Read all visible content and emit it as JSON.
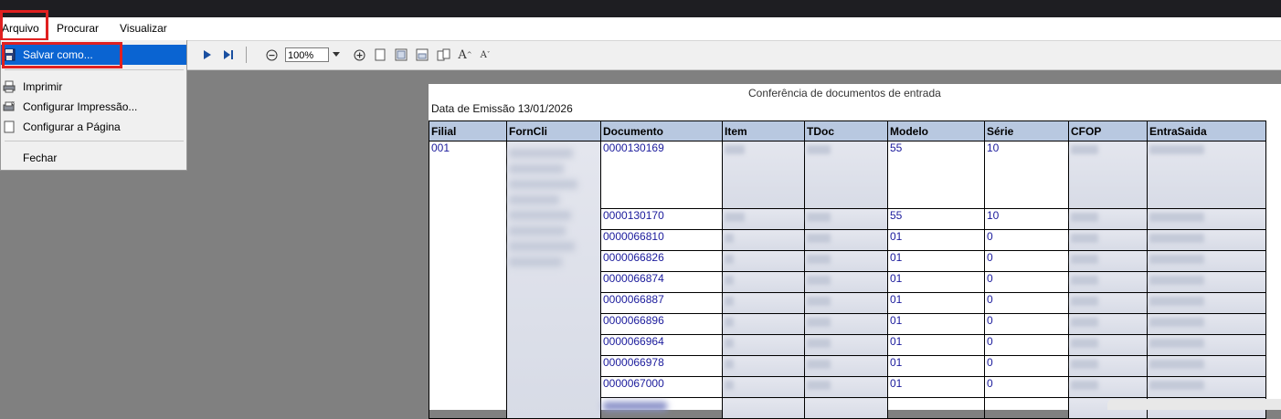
{
  "menubar": {
    "items": [
      {
        "label": "Arquivo"
      },
      {
        "label": "Procurar"
      },
      {
        "label": "Visualizar"
      }
    ]
  },
  "dropdown": {
    "items": [
      {
        "label": "Salvar como...",
        "icon": "save-icon",
        "highlighted": true
      },
      {
        "label": "Imprimir",
        "icon": "printer-icon"
      },
      {
        "label": "Configurar Impressão...",
        "icon": "print-setup-icon"
      },
      {
        "label": "Configurar a Página",
        "icon": "page-setup-icon"
      },
      {
        "label": "Fechar",
        "icon": ""
      }
    ]
  },
  "toolbar": {
    "zoom_value": "100%"
  },
  "report": {
    "title": "Conferência de documentos de entrada",
    "emission": "Data de Emissão 13/01/2026",
    "columns": [
      "Filial",
      "FornCli",
      "Documento",
      "Item",
      "TDoc",
      "Modelo",
      "Série",
      "CFOP",
      "EntraSaida"
    ],
    "filial": "001",
    "rows": [
      {
        "documento": "0000130169",
        "modelo": "55",
        "serie": "10"
      },
      {
        "documento": "0000130170",
        "modelo": "55",
        "serie": "10"
      },
      {
        "documento": "0000066810",
        "modelo": "01",
        "serie": "0"
      },
      {
        "documento": "0000066826",
        "modelo": "01",
        "serie": "0"
      },
      {
        "documento": "0000066874",
        "modelo": "01",
        "serie": "0"
      },
      {
        "documento": "0000066887",
        "modelo": "01",
        "serie": "0"
      },
      {
        "documento": "0000066896",
        "modelo": "01",
        "serie": "0"
      },
      {
        "documento": "0000066964",
        "modelo": "01",
        "serie": "0"
      },
      {
        "documento": "0000066978",
        "modelo": "01",
        "serie": "0"
      },
      {
        "documento": "0000067000",
        "modelo": "01",
        "serie": "0"
      }
    ]
  },
  "colors": {
    "menu_highlight": "#0a64d2",
    "annotation_red": "#e02020",
    "header_fill": "#b8c8e0",
    "cell_text": "#1b1b9c"
  }
}
